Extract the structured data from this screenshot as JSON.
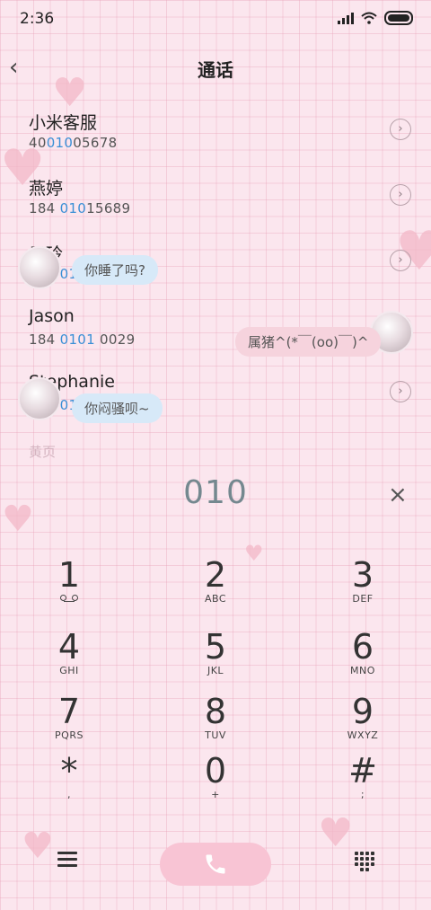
{
  "status": {
    "time": "2:36"
  },
  "header": {
    "title": "通话",
    "back_icon": "chevron-left-icon"
  },
  "contacts": [
    {
      "name": "小米客服",
      "num_pre": "40",
      "num_hl": "010",
      "num_post": "05678"
    },
    {
      "name": "燕婷",
      "num_pre": "184 ",
      "num_hl": "010",
      "num_post": "15689"
    },
    {
      "name": "子玲",
      "num_pre": "184 ",
      "num_hl": "0101",
      "num_post": " 5678"
    },
    {
      "name": "Jason",
      "num_pre": "184 ",
      "num_hl": "0101",
      "num_post": " 0029"
    },
    {
      "name": "Stephanie",
      "num_pre": "184 ",
      "num_hl": "0102",
      "num_post": " 4685"
    }
  ],
  "bubbles": {
    "b1": "你睡了吗?",
    "b2": "属猪^(*￣(oo)￣)^",
    "b3": "你闷骚呗~"
  },
  "faded_text": "黄页",
  "dialer": {
    "digits": "010",
    "clear_icon": "×"
  },
  "keys": [
    {
      "d": "1",
      "l": ""
    },
    {
      "d": "2",
      "l": "ABC"
    },
    {
      "d": "3",
      "l": "DEF"
    },
    {
      "d": "4",
      "l": "GHI"
    },
    {
      "d": "5",
      "l": "JKL"
    },
    {
      "d": "6",
      "l": "MNO"
    },
    {
      "d": "7",
      "l": "PQRS"
    },
    {
      "d": "8",
      "l": "TUV"
    },
    {
      "d": "9",
      "l": "WXYZ"
    },
    {
      "d": "*",
      "l": ","
    },
    {
      "d": "0",
      "l": "+"
    },
    {
      "d": "#",
      "l": ";"
    }
  ],
  "colors": {
    "background": "#fbe6ee",
    "call_button": "#f8c4d4",
    "highlight": "#3a8fd6",
    "digits": "#74888f"
  }
}
